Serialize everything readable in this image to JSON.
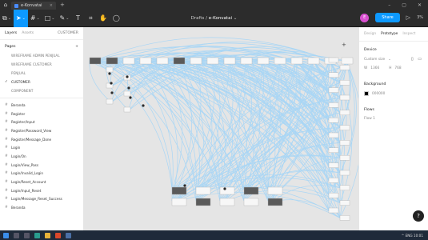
{
  "browser": {
    "tab_title": "e-Konvatai",
    "plus": "+",
    "window_controls": [
      "–",
      "▢",
      "✕"
    ]
  },
  "toolbar": {
    "tools": [
      {
        "name": "figma-menu",
        "glyph": "⧉"
      },
      {
        "name": "move",
        "glyph": "➤"
      },
      {
        "name": "frame",
        "glyph": "#"
      },
      {
        "name": "shape",
        "glyph": "□"
      },
      {
        "name": "pen",
        "glyph": "✎"
      },
      {
        "name": "text",
        "glyph": "T"
      },
      {
        "name": "resources",
        "glyph": "⌗"
      },
      {
        "name": "hand",
        "glyph": "✋"
      },
      {
        "name": "comment",
        "glyph": "◯"
      }
    ],
    "drafts": "Drafts",
    "separator": "/",
    "file_name": "e-Konvatai",
    "file_caret": "⌄",
    "avatar_initial": "E",
    "share_label": "Share",
    "play_glyph": "▷",
    "zoom": "3%"
  },
  "left_panel": {
    "tabs": [
      "Layers",
      "Assets",
      "CUSTOMER"
    ],
    "pages_heading": "Pages",
    "pages_add": "+",
    "pages": [
      {
        "label": "WIREFRAME ADMIN PENJUAL",
        "current": false
      },
      {
        "label": "WIREFRAME CUSTOMER",
        "current": false
      },
      {
        "label": "PENJUAL",
        "current": false
      },
      {
        "label": "CUSTOMER",
        "current": true
      },
      {
        "label": "COMPONENT",
        "current": false
      }
    ],
    "check_glyph": "✓",
    "hash_glyph": "#",
    "layers": [
      "Beranda",
      "Register",
      "Register/Input",
      "Register/Password_View",
      "Register/Message_Done",
      "Login",
      "Login/On",
      "Login/View_Pass",
      "Login/Invalid_Login",
      "Login/Reset_Account",
      "Login/Input_Reset",
      "Login/Message_Reset_Success",
      "Beranda"
    ]
  },
  "right_panel": {
    "tabs": [
      "Design",
      "Prototype",
      "Inspect"
    ],
    "device_heading": "Device",
    "device_value": "Custom size",
    "device_caret": "⌄",
    "orient_glyphs": "▯ ▭",
    "width_label": "W",
    "width_value": "1366",
    "height_label": "H",
    "height_value": "768",
    "background_heading": "Background",
    "background_value": "000000",
    "background_color": "#000000",
    "flows_heading": "Flows",
    "flow_item": "Flow 1"
  },
  "help_label": "?",
  "taskbar": {
    "tray_text": "^  ENG  10:01"
  },
  "colors": {
    "accent": "#0d99ff",
    "connector": "#a9d6f5",
    "canvas": "#e5e5e5"
  }
}
